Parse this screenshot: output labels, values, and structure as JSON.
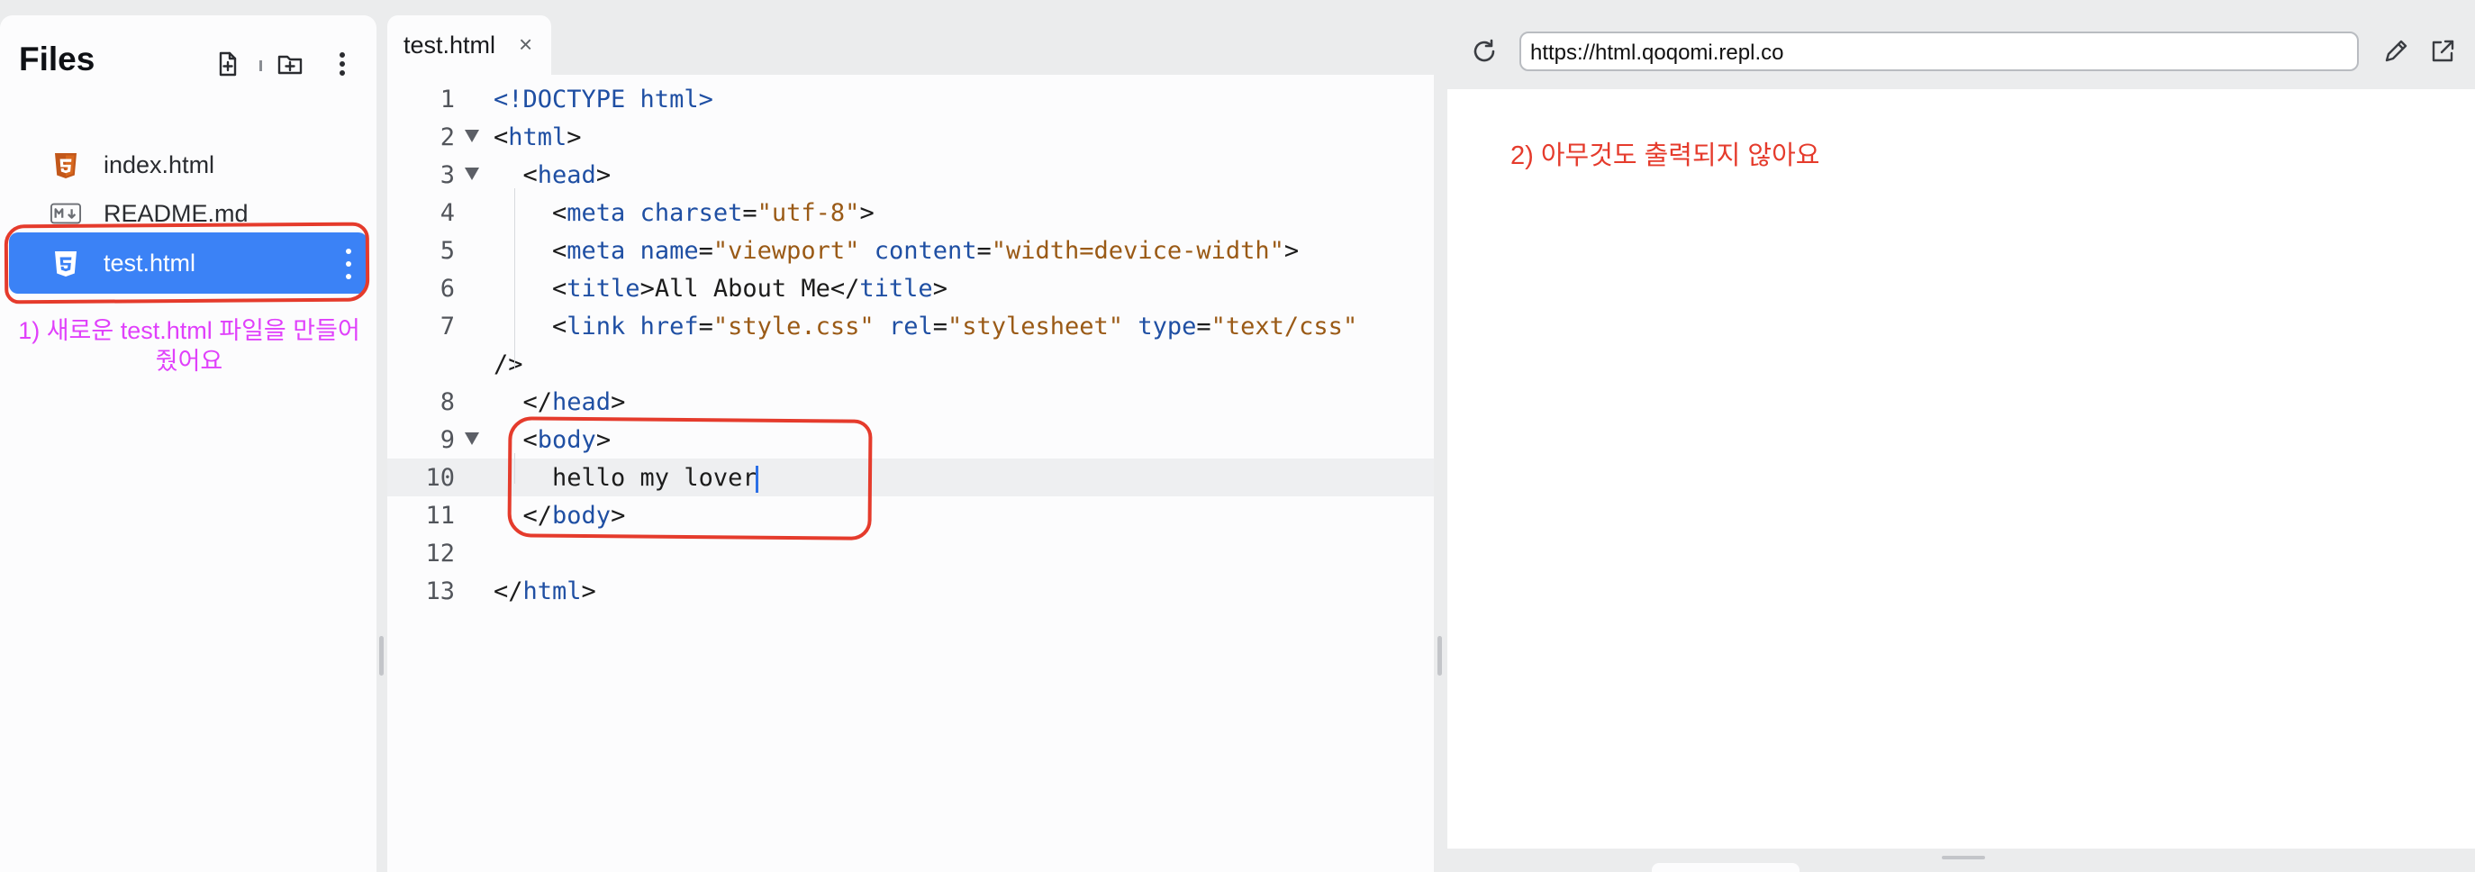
{
  "files": {
    "title": "Files",
    "items": [
      {
        "name": "index.html",
        "icon": "html5-icon"
      },
      {
        "name": "README.md",
        "icon": "markdown-icon"
      },
      {
        "name": "test.html",
        "icon": "html5-icon",
        "active": true
      }
    ],
    "annotation": "1) 새로운 test.html 파일을 만들어줬어요"
  },
  "editor": {
    "tab": {
      "label": "test.html",
      "close": "×"
    },
    "line_numbers": [
      "1",
      "2",
      "3",
      "4",
      "5",
      "6",
      "7",
      "",
      "8",
      "9",
      "10",
      "11",
      "12",
      "13"
    ],
    "lines": [
      [
        {
          "c": "tag",
          "t": "<!DOCTYPE html>"
        }
      ],
      [
        {
          "c": "txt",
          "t": "<"
        },
        {
          "c": "tag",
          "t": "html"
        },
        {
          "c": "txt",
          "t": ">"
        }
      ],
      [
        {
          "c": "txt",
          "t": "  <"
        },
        {
          "c": "tag",
          "t": "head"
        },
        {
          "c": "txt",
          "t": ">"
        }
      ],
      [
        {
          "c": "txt",
          "t": "    <"
        },
        {
          "c": "tag",
          "t": "meta"
        },
        {
          "c": "txt",
          "t": " "
        },
        {
          "c": "attr",
          "t": "charset"
        },
        {
          "c": "txt",
          "t": "="
        },
        {
          "c": "str",
          "t": "\"utf-8\""
        },
        {
          "c": "txt",
          "t": ">"
        }
      ],
      [
        {
          "c": "txt",
          "t": "    <"
        },
        {
          "c": "tag",
          "t": "meta"
        },
        {
          "c": "txt",
          "t": " "
        },
        {
          "c": "attr",
          "t": "name"
        },
        {
          "c": "txt",
          "t": "="
        },
        {
          "c": "str",
          "t": "\"viewport\""
        },
        {
          "c": "txt",
          "t": " "
        },
        {
          "c": "attr",
          "t": "content"
        },
        {
          "c": "txt",
          "t": "="
        },
        {
          "c": "str",
          "t": "\"width=device-width\""
        },
        {
          "c": "txt",
          "t": ">"
        }
      ],
      [
        {
          "c": "txt",
          "t": "    <"
        },
        {
          "c": "tag",
          "t": "title"
        },
        {
          "c": "txt",
          "t": ">All About Me</"
        },
        {
          "c": "tag",
          "t": "title"
        },
        {
          "c": "txt",
          "t": ">"
        }
      ],
      [
        {
          "c": "txt",
          "t": "    <"
        },
        {
          "c": "tag",
          "t": "link"
        },
        {
          "c": "txt",
          "t": " "
        },
        {
          "c": "attr",
          "t": "href"
        },
        {
          "c": "txt",
          "t": "="
        },
        {
          "c": "str",
          "t": "\"style.css\""
        },
        {
          "c": "txt",
          "t": " "
        },
        {
          "c": "attr",
          "t": "rel"
        },
        {
          "c": "txt",
          "t": "="
        },
        {
          "c": "str",
          "t": "\"stylesheet\""
        },
        {
          "c": "txt",
          "t": " "
        },
        {
          "c": "attr",
          "t": "type"
        },
        {
          "c": "txt",
          "t": "="
        },
        {
          "c": "str",
          "t": "\"text/css\""
        }
      ],
      [
        {
          "c": "txt",
          "t": "/>"
        }
      ],
      [
        {
          "c": "txt",
          "t": "  </"
        },
        {
          "c": "tag",
          "t": "head"
        },
        {
          "c": "txt",
          "t": ">"
        }
      ],
      [
        {
          "c": "txt",
          "t": "  <"
        },
        {
          "c": "tag",
          "t": "body"
        },
        {
          "c": "txt",
          "t": ">"
        }
      ],
      [
        {
          "c": "txt",
          "t": "    hello my lover"
        }
      ],
      [
        {
          "c": "txt",
          "t": "  </"
        },
        {
          "c": "tag",
          "t": "body"
        },
        {
          "c": "txt",
          "t": ">"
        }
      ],
      [
        {
          "c": "txt",
          "t": ""
        }
      ],
      [
        {
          "c": "txt",
          "t": "</"
        },
        {
          "c": "tag",
          "t": "html"
        },
        {
          "c": "txt",
          "t": ">"
        }
      ]
    ],
    "foldable_lines": [
      "2",
      "3",
      "9"
    ],
    "active_line": "10"
  },
  "preview": {
    "url": "https://html.qoqomi.repl.co",
    "annotation": "2) 아무것도 출력되지 않아요"
  },
  "colors": {
    "accent": "#3b82f6",
    "annotation_red": "#e53b2c",
    "annotation_magenta": "#e040fb"
  }
}
